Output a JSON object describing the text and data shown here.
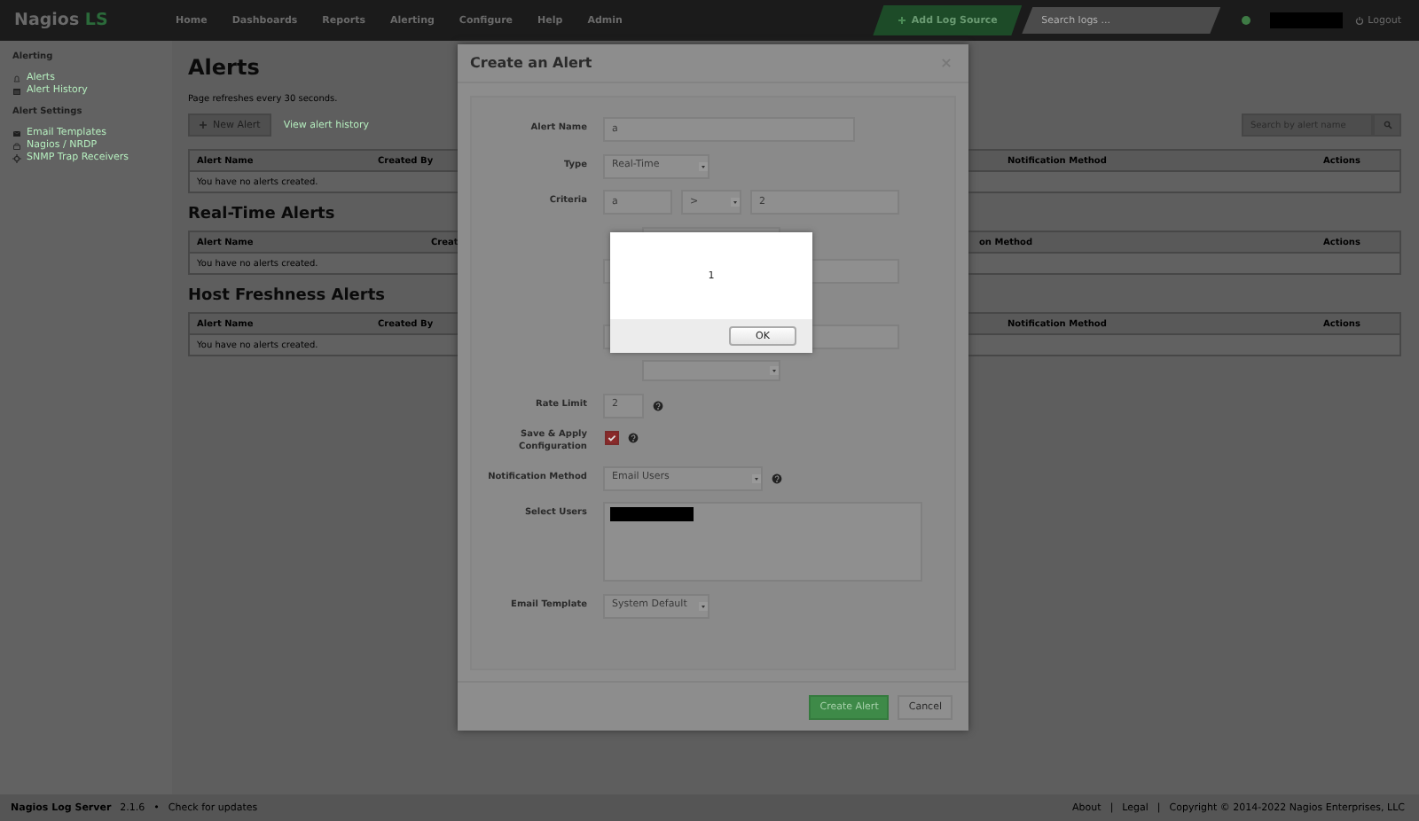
{
  "navbar": {
    "logo": "Nagios",
    "logo_suffix": "LS",
    "menu": [
      {
        "label": "Home"
      },
      {
        "label": "Dashboards"
      },
      {
        "label": "Reports"
      },
      {
        "label": "Alerting"
      },
      {
        "label": "Configure"
      },
      {
        "label": "Help"
      },
      {
        "label": "Admin"
      }
    ],
    "add_button": "Add Log Source",
    "search": {
      "placeholder": "Search logs ..."
    },
    "logout": "Logout"
  },
  "sidebar": {
    "sections": [
      {
        "title": "Alerting",
        "items": [
          {
            "label": "Alerts"
          },
          {
            "label": "Alert History"
          }
        ]
      },
      {
        "title": "Alert Settings",
        "items": [
          {
            "label": "Email Templates"
          },
          {
            "label": "Nagios / NRDP"
          },
          {
            "label": "SNMP Trap Receivers"
          }
        ]
      }
    ]
  },
  "main": {
    "title": "Alerts",
    "refresh_note": "Page refreshes every 30 seconds.",
    "new_button": "New Alert",
    "history_link": "View alert history",
    "search": {
      "placeholder": "Search by alert name"
    },
    "tables": [
      {
        "columns": [
          "Alert Name",
          "Created By",
          "Notification Method",
          "Actions"
        ],
        "empty": "You have no alerts created."
      },
      {
        "title": "Real-Time Alerts",
        "columns": [
          "Alert Name",
          "Creat",
          "on Method",
          "Actions"
        ],
        "empty": "You have no alerts created."
      },
      {
        "title": "Host Freshness Alerts",
        "columns": [
          "Alert Name",
          "Created By",
          "Notification Method",
          "Actions"
        ],
        "empty": "You have no alerts created."
      }
    ]
  },
  "modal": {
    "title": "Create an Alert",
    "fields": [
      {
        "kind": "text",
        "label": "Alert Name",
        "value": "a"
      },
      {
        "kind": "select",
        "label": "Type",
        "value": "Real-Time"
      },
      {
        "kind": "criteria",
        "label": "Criteria",
        "value": "a",
        "operator": ">",
        "threshold": "2"
      },
      {
        "kind": "subselect"
      },
      {
        "kind": "wide"
      },
      {
        "kind": "wide"
      },
      {
        "kind": "subselect"
      },
      {
        "kind": "number",
        "label": "Rate Limit",
        "value": "2",
        "help": true
      },
      {
        "kind": "checkbox",
        "label": "Save & Apply Configuration",
        "checked": true,
        "help": true
      },
      {
        "kind": "select",
        "label": "Notification Method",
        "value": "Email Users",
        "help": true
      },
      {
        "kind": "users",
        "label": "Select Users"
      },
      {
        "kind": "select",
        "label": "Email Template",
        "value": "System Default"
      }
    ],
    "buttons": [
      {
        "label": "Create Alert",
        "primary": true
      },
      {
        "label": "Cancel",
        "primary": false
      }
    ]
  },
  "dialog": {
    "message": "1",
    "button": "OK"
  },
  "footer": {
    "product": "Nagios Log Server",
    "version": "2.1.6",
    "separator": "•",
    "update_link": "Check for updates",
    "links": [
      "About",
      "Legal"
    ],
    "divider": "|",
    "copyright": "Copyright © 2014-2022 Nagios Enterprises, LLC"
  }
}
